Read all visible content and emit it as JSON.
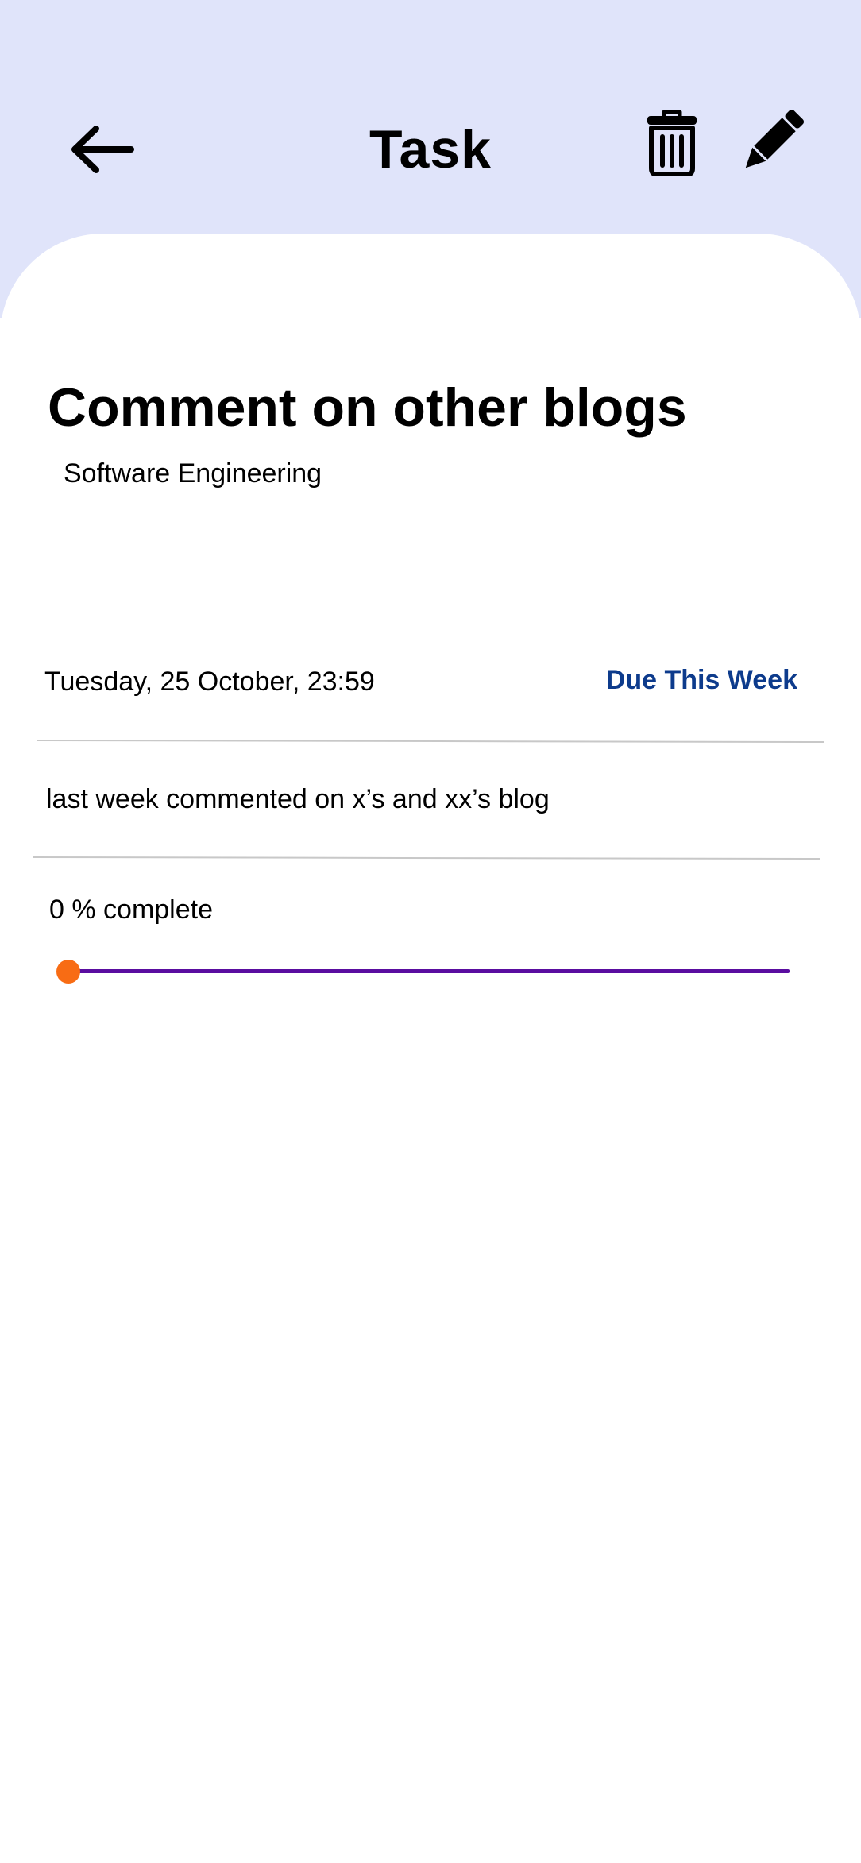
{
  "header": {
    "title": "Task",
    "background_color": "#e0e4fa",
    "back_icon": "arrow-left-icon",
    "delete_icon": "trash-icon",
    "edit_icon": "pencil-icon"
  },
  "task": {
    "title": "Comment on other blogs",
    "category": "Software Engineering",
    "due_datetime": "Tuesday, 25 October, 23:59",
    "due_status": "Due This Week",
    "due_status_color": "#0d3b8c",
    "notes": "last week commented on x’s and xx’s blog"
  },
  "progress": {
    "value": 0,
    "suffix": " % complete",
    "track_color": "#5a0da0",
    "thumb_color": "#f86c14"
  }
}
